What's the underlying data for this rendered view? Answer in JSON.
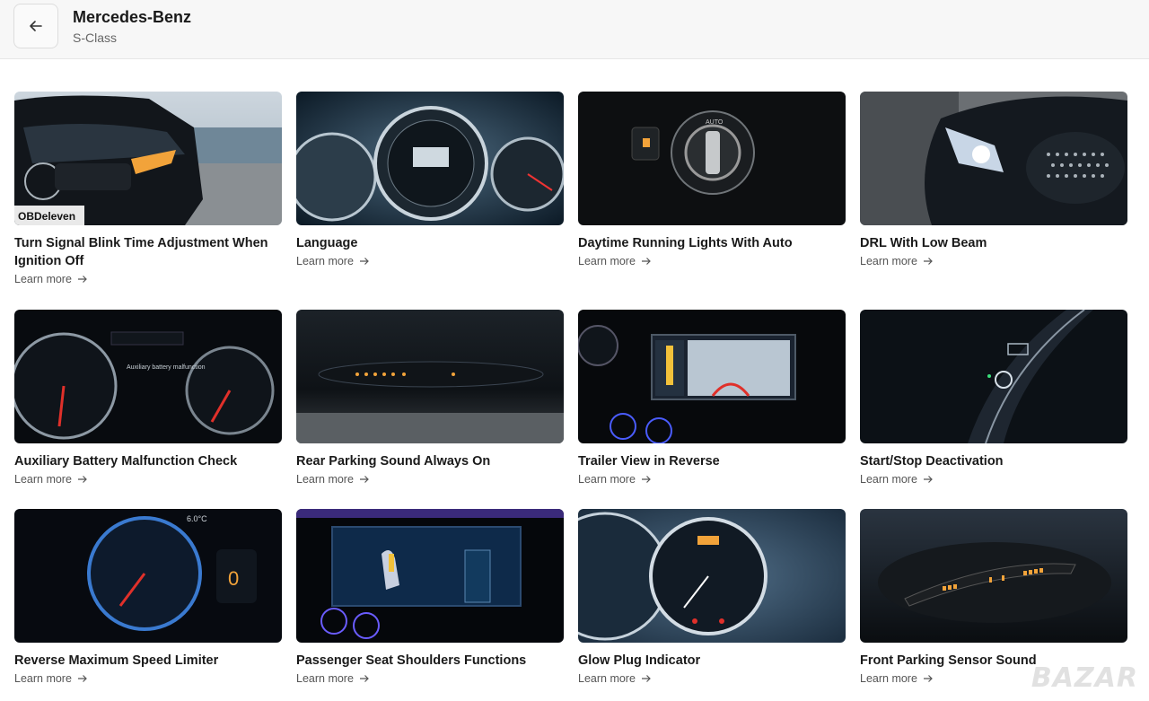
{
  "header": {
    "title": "Mercedes-Benz",
    "subtitle": "S-Class",
    "back_icon": "arrow-left-icon"
  },
  "learn_more_label": "Learn more",
  "cards": [
    {
      "title": "Turn Signal Blink Time Adjustment When Ignition Off",
      "image_text": "OBDeleven"
    },
    {
      "title": "Language"
    },
    {
      "title": "Daytime Running Lights With Auto",
      "image_text": "AUTO"
    },
    {
      "title": "DRL With Low Beam"
    },
    {
      "title": "Auxiliary Battery Malfunction Check",
      "image_text": "Auxiliary battery malfunction"
    },
    {
      "title": "Rear Parking Sound Always On"
    },
    {
      "title": "Trailer View in Reverse"
    },
    {
      "title": "Start/Stop Deactivation"
    },
    {
      "title": "Reverse Maximum Speed Limiter",
      "image_text": "6.0°C"
    },
    {
      "title": "Passenger Seat Shoulders Functions"
    },
    {
      "title": "Glow Plug Indicator"
    },
    {
      "title": "Front Parking Sensor Sound"
    }
  ],
  "watermark": "BAZAR",
  "colors": {
    "header_bg": "#f7f7f7",
    "text": "#1a1a1a",
    "muted": "#555555",
    "accent_amber": "#f2a33a",
    "accent_red": "#e0302a"
  }
}
